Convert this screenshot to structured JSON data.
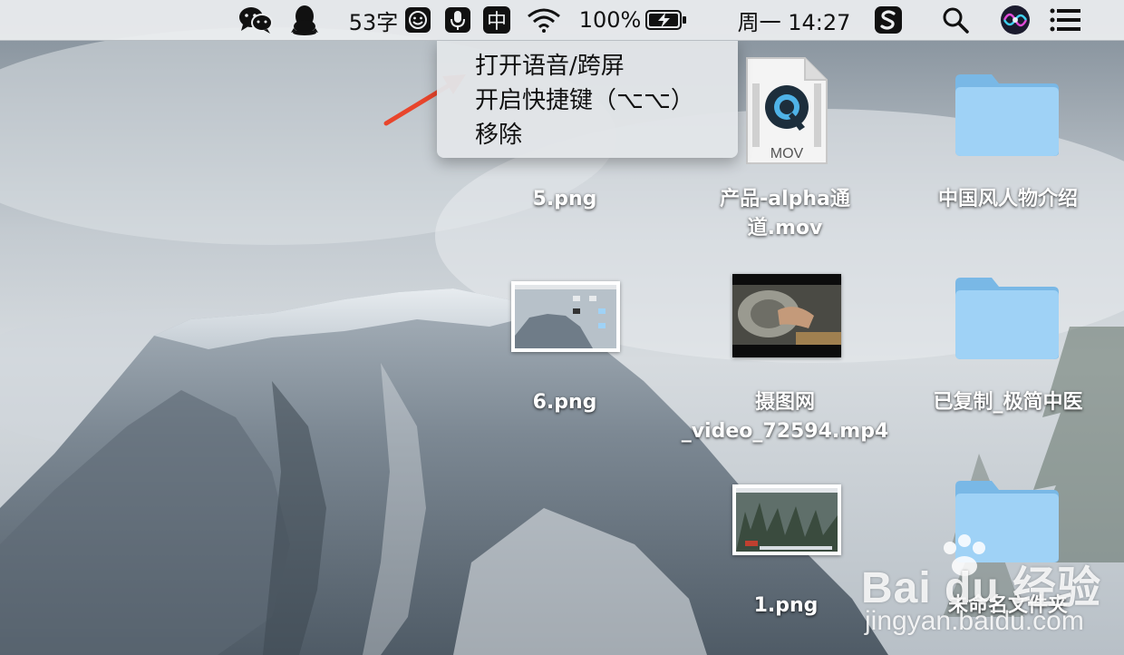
{
  "menubar": {
    "wechat_icon": "wechat-icon",
    "qq_icon": "qq-icon",
    "word_count": "53字",
    "emoji_icon": "emoji-icon",
    "mic_icon": "microphone-icon",
    "input_method": "中",
    "wifi_icon": "wifi-icon",
    "battery_percent": "100%",
    "battery_icon": "battery-charging-icon",
    "clock": "周一 14:27",
    "sogou_icon": "sogou-icon",
    "search_icon": "spotlight-search-icon",
    "siri_icon": "siri-icon",
    "notification_icon": "notification-center-icon"
  },
  "dropdown": {
    "items": [
      {
        "label": "打开语音/跨屏"
      },
      {
        "label": "开启快捷键（⌥⌥）"
      },
      {
        "label": "移除"
      }
    ]
  },
  "desktop": {
    "items": [
      {
        "name": "5.png",
        "kind": "image"
      },
      {
        "name": "产品-alpha通道.mov",
        "line1": "产品-alpha通",
        "line2": "道.mov",
        "kind": "movie",
        "badge": "MOV"
      },
      {
        "name": "中国风人物介绍",
        "kind": "folder"
      },
      {
        "name": "6.png",
        "kind": "image"
      },
      {
        "name": "摄图网_video_72594.mp4",
        "line1": "摄图网",
        "line2": "_video_72594.mp4",
        "kind": "video"
      },
      {
        "name": "已复制_极简中医",
        "kind": "folder"
      },
      {
        "name": "1.png",
        "kind": "image"
      },
      {
        "name": "未命名文件夹",
        "kind": "folder"
      }
    ]
  },
  "watermark": {
    "logo": "Bai du 经验",
    "url": "jingyan.baidu.com"
  },
  "colors": {
    "menubar_bg": "#eceef0",
    "folder_blue": "#8cc8f0",
    "arrow_red": "#e8452c",
    "label_text": "#ffffff"
  }
}
